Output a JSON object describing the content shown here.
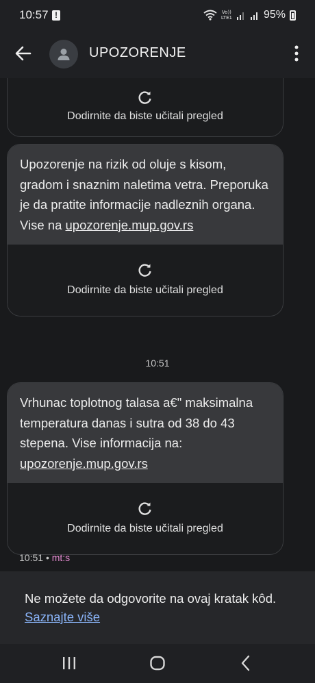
{
  "status_bar": {
    "time": "10:57",
    "notification_icon": "alert-icon",
    "network_label_top": "Vo))",
    "network_label_bottom": "LTE1",
    "battery": "95%"
  },
  "app_bar": {
    "title": "UPOZORENJE",
    "back_icon": "arrow-left-icon",
    "avatar_icon": "person-icon",
    "menu_icon": "more-vert-icon"
  },
  "messages": [
    {
      "preview_label": "Dodirnite da biste učitali pregled"
    },
    {
      "text": "Upozorenje na rizik od oluje s kisom, gradom i snaznim naletima vetra. Preporuka je da pratite informacije nadleznih organa. Vise na",
      "link": "upozorenje.mup.gov.rs",
      "preview_label": "Dodirnite da biste učitali pregled"
    },
    {
      "text": "Vrhunac toplotnog talasa a€\" maksimalna temperatura danas i sutra od 38 do 43 stepena. Vise informacija na:",
      "link": "upozorenje.mup.gov.rs",
      "preview_label": "Dodirnite da biste učitali pregled"
    }
  ],
  "timestamp_divider": "10:51",
  "last_message_meta": {
    "time": "10:51",
    "separator": "•",
    "sender": "mt:s"
  },
  "notice": {
    "text": "Ne možete da odgovorite na ovaj kratak kôd.",
    "link": "Saznajte više"
  },
  "colors": {
    "background": "#1f2023",
    "bubble": "#38393c",
    "link_blue": "#8ab4f8",
    "sender_pink": "#e48ad0"
  }
}
